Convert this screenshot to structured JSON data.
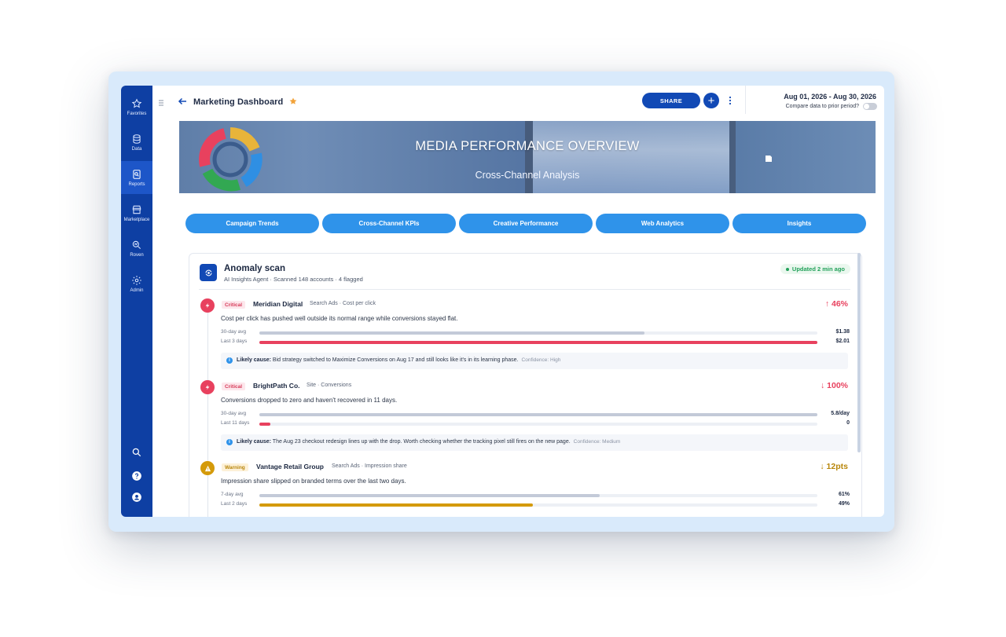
{
  "sidebar": {
    "items": [
      {
        "label": "Favorites",
        "icon": "star-icon"
      },
      {
        "label": "Data",
        "icon": "database-icon"
      },
      {
        "label": "Reports",
        "icon": "report-icon",
        "active": true
      },
      {
        "label": "Marketplace",
        "icon": "store-icon"
      },
      {
        "label": "Roven",
        "icon": "magnify-chart-icon"
      },
      {
        "label": "Admin",
        "icon": "gear-icon"
      }
    ],
    "bottom": [
      "search-icon",
      "help-icon",
      "user-icon"
    ]
  },
  "header": {
    "title": "Marketing Dashboard",
    "share_label": "SHARE",
    "plus_label": "+",
    "date_range": "Aug 01, 2026 - Aug 30, 2026",
    "compare_label": "Compare data to prior period?"
  },
  "banner": {
    "title": "MEDIA PERFORMANCE OVERVIEW",
    "subtitle": "Cross-Channel Analysis"
  },
  "tabs": [
    {
      "label": "Campaign Trends"
    },
    {
      "label": "Cross-Channel KPIs"
    },
    {
      "label": "Creative Performance"
    },
    {
      "label": "Web Analytics"
    },
    {
      "label": "Insights"
    }
  ],
  "anomaly_scan": {
    "title": "Anomaly scan",
    "subtitle": "AI Insights Agent · Scanned 148 accounts · 4 flagged",
    "updated": "Updated 2 min ago",
    "items": [
      {
        "severity": "Critical",
        "account": "Meridian Digital",
        "meta": "Search Ads · Cost per click",
        "delta": "↑ 46%",
        "description": "Cost per click has pushed well outside its normal range while conversions stayed flat.",
        "bars": [
          {
            "label": "30-day avg",
            "value": "$1.38",
            "fill": 0.69,
            "color": "#c3cad8"
          },
          {
            "label": "Last 3 days",
            "value": "$2.01",
            "fill": 1.0,
            "color": "#e8415e"
          }
        ],
        "cause_label": "Likely cause:",
        "cause": "Bid strategy switched to Maximize Conversions on Aug 17 and still looks like it's in its learning phase.",
        "confidence": "Confidence: High"
      },
      {
        "severity": "Critical",
        "account": "BrightPath Co.",
        "meta": "Site · Conversions",
        "delta": "↓ 100%",
        "description": "Conversions dropped to zero and haven't recovered in 11 days.",
        "bars": [
          {
            "label": "30-day avg",
            "value": "5.8/day",
            "fill": 1.0,
            "color": "#c3cad8"
          },
          {
            "label": "Last 11 days",
            "value": "0",
            "fill": 0.02,
            "color": "#e8415e"
          }
        ],
        "cause_label": "Likely cause:",
        "cause": "The Aug 23 checkout redesign lines up with the drop. Worth checking whether the tracking pixel still fires on the new page.",
        "confidence": "Confidence: Medium"
      },
      {
        "severity": "Warning",
        "account": "Vantage Retail Group",
        "meta": "Search Ads · Impression share",
        "delta": "↓ 12pts",
        "description": "Impression share slipped on branded terms over the last two days.",
        "bars": [
          {
            "label": "7-day avg",
            "value": "61%",
            "fill": 0.61,
            "color": "#c3cad8"
          },
          {
            "label": "Last 2 days",
            "value": "49%",
            "fill": 0.49,
            "color": "#d49a0a"
          }
        ]
      }
    ]
  }
}
